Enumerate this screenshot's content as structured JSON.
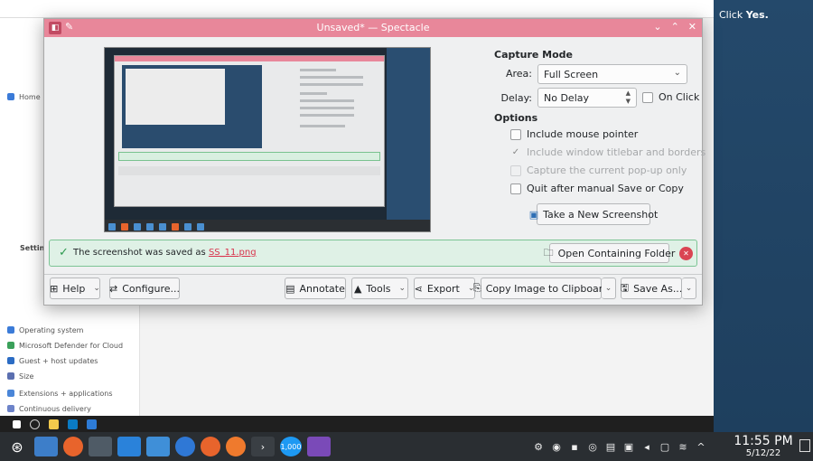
{
  "background": {
    "instruction_prefix": "Click ",
    "instruction_emphasis": "Yes.",
    "sidebar": {
      "home_label": "Home",
      "settings_heading": "Settings",
      "items": [
        {
          "label": "Operating system",
          "color": "#3b7bd8"
        },
        {
          "label": "Microsoft Defender for Cloud",
          "color": "#3aa05a"
        },
        {
          "label": "Guest + host updates",
          "color": "#2b6cc4"
        },
        {
          "label": "Size",
          "color": "#5b6fb0"
        },
        {
          "label": "Extensions + applications",
          "color": "#4a86d8"
        },
        {
          "label": "Continuous delivery",
          "color": "#6d83c9"
        }
      ]
    }
  },
  "spectacle": {
    "title": "Unsaved* — Spectacle",
    "capture_mode": {
      "heading": "Capture Mode",
      "area_label": "Area:",
      "area_value": "Full Screen",
      "delay_label": "Delay:",
      "delay_value": "No Delay",
      "on_click_label": "On Click"
    },
    "options": {
      "heading": "Options",
      "include_mouse_pointer": "Include mouse pointer",
      "include_titlebar": "Include window titlebar and borders",
      "capture_popup": "Capture the current pop-up only",
      "quit_after_save": "Quit after manual Save or Copy"
    },
    "take_screenshot_label": "Take a New Screenshot",
    "notification": {
      "message": "The screenshot was saved as ",
      "filename": "SS_11.png",
      "open_folder_label": "Open Containing Folder"
    },
    "toolbar": {
      "help": "Help",
      "configure": "Configure...",
      "annotate": "Annotate",
      "tools": "Tools",
      "export": "Export",
      "copy_clipboard": "Copy Image to Clipboard",
      "save_as": "Save As..."
    }
  },
  "taskbar": {
    "time": "11:55 PM",
    "date": "5/12/22",
    "badge_count": "1,000"
  }
}
